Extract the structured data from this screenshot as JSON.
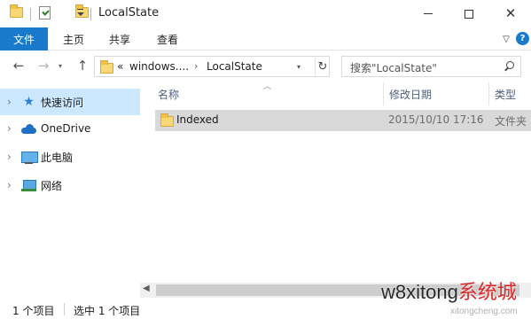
{
  "window": {
    "title": "LocalState",
    "minimize_icon": "minimize-icon",
    "maximize_icon": "maximize-icon",
    "close_icon": "close-icon"
  },
  "ribbon": {
    "tabs": [
      "文件",
      "主页",
      "共享",
      "查看"
    ],
    "active_tab_color": "#1979ca"
  },
  "address_bar": {
    "overflow": "«",
    "breadcrumbs": [
      "windows....",
      "LocalState"
    ]
  },
  "search": {
    "placeholder": "搜索\"LocalState\""
  },
  "nav_pane": {
    "items": [
      {
        "label": "快速访问",
        "icon": "quick-access-star-icon",
        "selected": true
      },
      {
        "label": "OneDrive",
        "icon": "cloud-icon",
        "selected": false
      },
      {
        "label": "此电脑",
        "icon": "this-pc-icon",
        "selected": false
      },
      {
        "label": "网络",
        "icon": "network-icon",
        "selected": false
      }
    ],
    "selected_color": "#cce8ff"
  },
  "file_list": {
    "columns": [
      "名称",
      "修改日期",
      "类型"
    ],
    "rows": [
      {
        "name": "Indexed",
        "modified": "2015/10/10 17:16",
        "type": "文件夹",
        "selected": true
      }
    ]
  },
  "status_bar": {
    "item_count": "1 个项目",
    "selected_count": "选中 1 个项目"
  },
  "watermark": {
    "latin": "w8xitong",
    "chinese": "系统城",
    "sub": "xitongcheng.com"
  }
}
